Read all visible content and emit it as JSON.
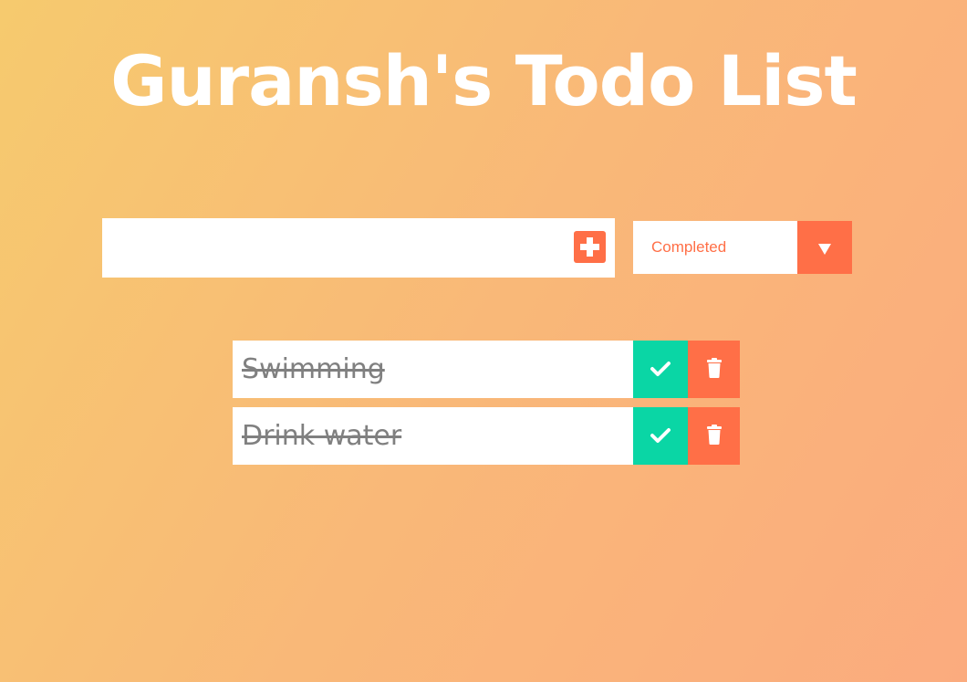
{
  "header": {
    "title": "Guransh's Todo List"
  },
  "form": {
    "input_value": "",
    "add_icon": "plus-square-icon",
    "filter": {
      "selected": "Completed",
      "arrow_icon": "caret-down-icon"
    }
  },
  "todos": [
    {
      "text": "Swimming",
      "completed": true
    },
    {
      "text": "Drink water",
      "completed": true
    }
  ],
  "icons": {
    "complete": "check-icon",
    "delete": "trash-icon"
  },
  "colors": {
    "accent": "#ff6f47",
    "complete": "#0ad6a5",
    "gradient_start": "#f6ca6e",
    "gradient_end": "#fbab7e",
    "completed_text": "#808080"
  }
}
